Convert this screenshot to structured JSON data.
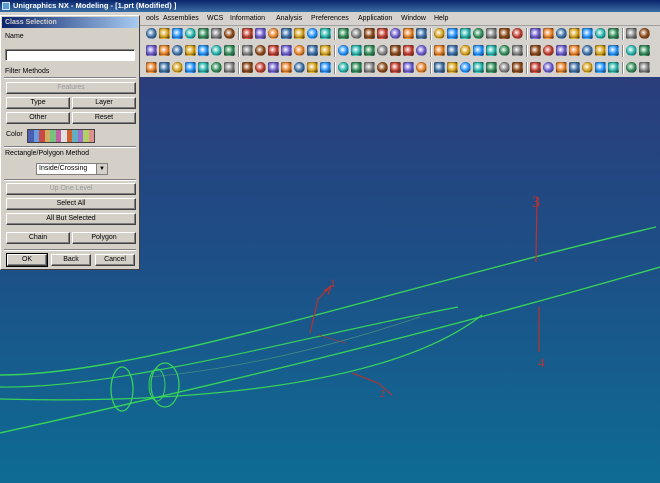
{
  "window": {
    "title": "Unigraphics NX - Modeling - [1.prt (Modified) ]"
  },
  "menubar": {
    "items": [
      "ools",
      "Assemblies",
      "WCS",
      "Information",
      "Analysis",
      "Preferences",
      "Application",
      "Window",
      "Help"
    ]
  },
  "dialog": {
    "title": "Class Selection",
    "name_label": "Name",
    "name_value": "",
    "filter_methods_label": "Filter Methods",
    "features_button": "Features",
    "type_button": "Type",
    "layer_button": "Layer",
    "other_button": "Other",
    "reset_button": "Reset",
    "color_label": "Color",
    "color_swatches": [
      "#4a5fb0",
      "#6a9ce0",
      "#c94848",
      "#d0b060",
      "#78c080",
      "#c060a0",
      "#e0e0e0",
      "#d06030",
      "#60b0c0",
      "#a070d0",
      "#b0d060",
      "#e09090"
    ],
    "rect_polygon_label": "Rectangle/Polygon Method",
    "rect_polygon_value": "Inside/Crossing",
    "up_one_level_button": "Up One Level",
    "select_all_button": "Select All",
    "all_but_selected_button": "All But Selected",
    "chain_button": "Chain",
    "polygon_button": "Polygon",
    "ok_button": "OK",
    "back_button": "Back",
    "cancel_button": "Cancel"
  },
  "annotations": {
    "label_1": "1",
    "label_2": "2",
    "label_3": "3",
    "label_4": "4"
  },
  "colors": {
    "curve_green": "#38d25a",
    "annotation_red": "#b8322f",
    "viewport_top": "#2a3d7c",
    "viewport_bottom": "#0e6c94"
  }
}
